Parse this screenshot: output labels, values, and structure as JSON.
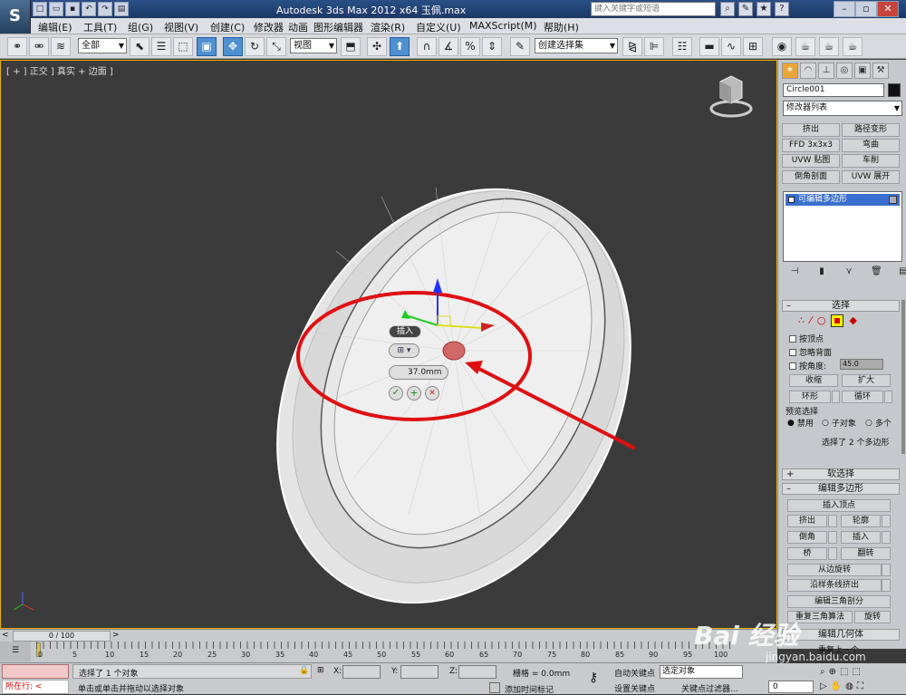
{
  "app": {
    "title": "Autodesk 3ds Max  2012 x64     玉佩.max",
    "search_placeholder": "键入关键字或短语",
    "logo": "S"
  },
  "menus": [
    "编辑(E)",
    "工具(T)",
    "组(G)",
    "视图(V)",
    "创建(C)",
    "修改器",
    "动画",
    "图形编辑器",
    "渲染(R)",
    "自定义(U)",
    "MAXScript(M)",
    "帮助(H)"
  ],
  "toolbar": {
    "filter": "全部",
    "ref_coord": "视图",
    "selection_set": "创建选择集"
  },
  "viewport": {
    "label": "[ + ] 正交 ] 真实 + 边面 ]",
    "caddy": {
      "title": "插入",
      "amount": "37.0mm"
    }
  },
  "panel": {
    "object_name": "Circle001",
    "modifier_list": "修改器列表",
    "buttons": [
      "挤出",
      "路径变形",
      "FFD 3x3x3",
      "弯曲",
      "UVW 贴图",
      "车削",
      "倒角剖面",
      "UVW 展开"
    ],
    "stack_item": "可编辑多边形",
    "selection": {
      "title": "选择",
      "by_vertex": "按顶点",
      "ignore_backfacing": "忽略背面",
      "by_angle": "按角度:",
      "angle_value": "45.0",
      "shrink": "收缩",
      "grow": "扩大",
      "ring": "环形",
      "loop": "循环",
      "preview_title": "预览选择",
      "preview_off": "禁用",
      "preview_subobj": "子对象",
      "preview_multi": "多个",
      "status": "选择了 2 个多边形"
    },
    "soft_selection": "软选择",
    "edit_polygons": {
      "title": "编辑多边形",
      "insert_vertex": "插入顶点",
      "extrude": "挤出",
      "outline": "轮廓",
      "bevel": "倒角",
      "inset": "插入",
      "bridge": "桥",
      "flip": "翻转",
      "hinge": "从边旋转",
      "extrude_spline": "沿样条线挤出",
      "edit_tri": "编辑三角剖分",
      "retriangulate": "重复三角算法",
      "turn": "旋转",
      "geometry": "编辑几何体",
      "repeat_last": "重复上一个"
    }
  },
  "timeline": {
    "frame": "0 / 100",
    "ticks": [
      "0",
      "5",
      "10",
      "15",
      "20",
      "25",
      "30",
      "35",
      "40",
      "45",
      "50",
      "55",
      "60",
      "65",
      "70",
      "75",
      "80",
      "85",
      "90",
      "95",
      "100"
    ]
  },
  "status": {
    "running": "所在行:",
    "line1": "选择了 1 个对象",
    "line2": "单击或单击并拖动以选择对象",
    "x": "X:",
    "y": "Y:",
    "z": "Z:",
    "grid": "栅格 = 0.0mm",
    "auto_key": "自动关键点",
    "set_key": "设置关键点",
    "selected": "选定对象",
    "key_filters": "关键点过滤器...",
    "add_time_tag": "添加时间标记",
    "frame_num": "0"
  },
  "watermark": "Bai 经验",
  "watermark_url": "jingyan.baidu.com"
}
